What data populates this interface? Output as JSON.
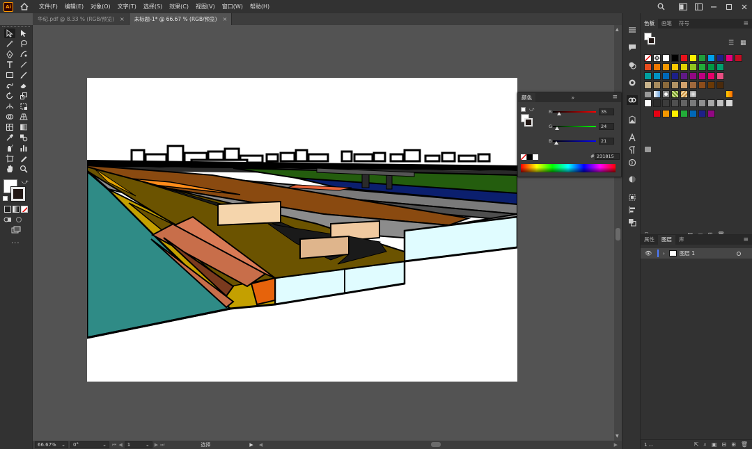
{
  "app": {
    "logo_text": "Ai"
  },
  "menu": [
    "文件(F)",
    "编辑(E)",
    "对象(O)",
    "文字(T)",
    "选择(S)",
    "效果(C)",
    "视图(V)",
    "窗口(W)",
    "帮助(H)"
  ],
  "tabs": [
    {
      "label": "华纪.pdf @ 8.33 % (RGB/预览)",
      "active": false,
      "close": "×"
    },
    {
      "label": "未标题-1* @ 66.67 % (RGB/预览)",
      "active": true,
      "close": "×"
    }
  ],
  "statusbar": {
    "zoom": "66.67%",
    "rotation": "0°",
    "artboard_nav": "1",
    "mode": "选择"
  },
  "swatches_panel": {
    "tabs": [
      "色板",
      "画笔",
      "符号"
    ],
    "active_tab": "色板",
    "colors_row1": [
      "#ffffff",
      "#000000",
      "#e8121b",
      "#ffef00",
      "#1f9e3a",
      "#00a0e9",
      "#1d2088",
      "#e4007f",
      "#c30d23"
    ],
    "colors_row2": [
      "#e84c1e",
      "#ee7800",
      "#f39800",
      "#fcc800",
      "#dfd000",
      "#8fc31f",
      "#22ac38",
      "#009944",
      "#00a06e"
    ],
    "colors_row3": [
      "#00a0a0",
      "#0093c4",
      "#0068b7",
      "#1d2088",
      "#601986",
      "#920783",
      "#be0081",
      "#e5006a",
      "#e94f83"
    ],
    "colors_row4": [
      "#c8b38c",
      "#a88b5e",
      "#8b6a3c",
      "#b29364",
      "#d1a16c",
      "#a0693d",
      "#8c4d1b",
      "#6a3906",
      "#4a2a0c"
    ],
    "grays_row": [
      "#ffffff",
      "#2b2b2b",
      "#3c3c3c",
      "#505050",
      "#646464",
      "#7a7a7a",
      "#909090",
      "#a8a8a8",
      "#c0c0c0",
      "#d8d8d8"
    ],
    "group_row": [
      "#e60012",
      "#f39800",
      "#fff100",
      "#22ac38",
      "#0068b7",
      "#1d2088",
      "#920783"
    ]
  },
  "color_panel": {
    "tab": "颜色",
    "r_label": "R",
    "g_label": "G",
    "b_label": "B",
    "r_value": "35",
    "g_value": "24",
    "b_value": "21",
    "r_level": 0.14,
    "g_level": 0.09,
    "b_level": 0.08,
    "hex_label": "#",
    "hex_value": "231815"
  },
  "layers_panel": {
    "tabs": [
      "属性",
      "图层",
      "库"
    ],
    "active_tab": "图层",
    "layer_name": "图层 1",
    "footer_count": "1 ..."
  }
}
